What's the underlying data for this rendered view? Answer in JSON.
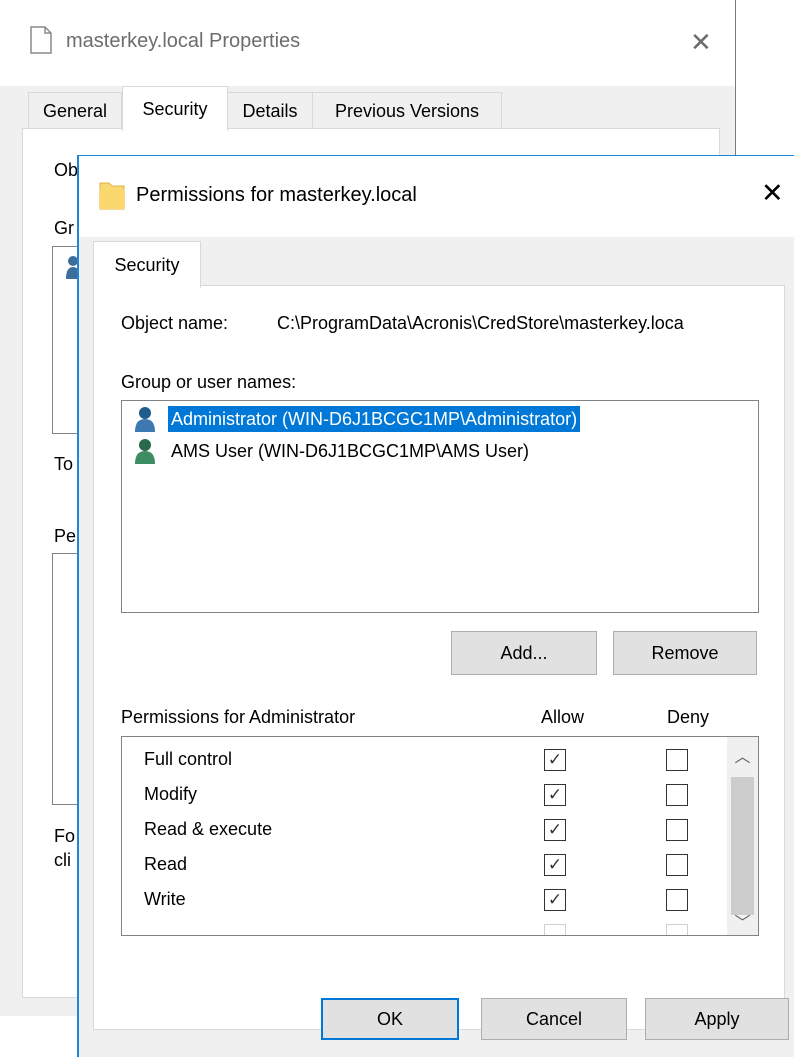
{
  "bg_window": {
    "title": "masterkey.local Properties",
    "tabs": [
      "General",
      "Security",
      "Details",
      "Previous Versions"
    ],
    "active_tab": "Security",
    "fragments": {
      "object": "Obj",
      "group": "Gr",
      "to": "To",
      "pe": "Pe",
      "fo": "Fo",
      "cli": "cli"
    }
  },
  "dialog": {
    "title": "Permissions for masterkey.local",
    "tab": "Security",
    "object_name_label": "Object name:",
    "object_name_value": "C:\\ProgramData\\Acronis\\CredStore\\masterkey.loca",
    "group_label": "Group or user names:",
    "users": [
      {
        "name": "Administrator (WIN-D6J1BCGC1MP\\Administrator)",
        "selected": true,
        "icon": "user-icon-blue"
      },
      {
        "name": "AMS User (WIN-D6J1BCGC1MP\\AMS User)",
        "selected": false,
        "icon": "user-icon-green"
      }
    ],
    "add_button": "Add...",
    "remove_button": "Remove",
    "permissions_label": "Permissions for Administrator",
    "allow_header": "Allow",
    "deny_header": "Deny",
    "permissions": [
      {
        "name": "Full control",
        "allow": true,
        "deny": false
      },
      {
        "name": "Modify",
        "allow": true,
        "deny": false
      },
      {
        "name": "Read & execute",
        "allow": true,
        "deny": false
      },
      {
        "name": "Read",
        "allow": true,
        "deny": false
      },
      {
        "name": "Write",
        "allow": true,
        "deny": false
      }
    ],
    "ok_button": "OK",
    "cancel_button": "Cancel",
    "apply_button": "Apply"
  },
  "colors": {
    "selection": "#0078d7",
    "dialog_border": "#1e86d8",
    "folder_icon": "#f8d775"
  }
}
